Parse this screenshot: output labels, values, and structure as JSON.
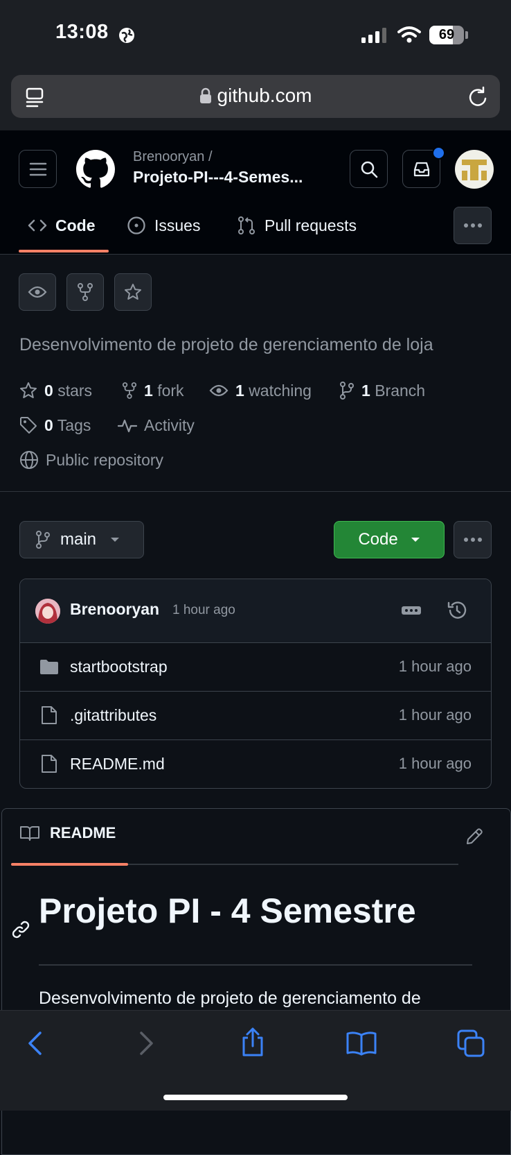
{
  "status_bar": {
    "time": "13:08",
    "battery": "69"
  },
  "browser": {
    "url": "github.com"
  },
  "header": {
    "owner": "Brenooryan /",
    "repo": "Projeto-PI---4-Semes..."
  },
  "nav": {
    "tabs": [
      {
        "label": "Code"
      },
      {
        "label": "Issues"
      },
      {
        "label": "Pull requests"
      }
    ]
  },
  "repo": {
    "description": "Desenvolvimento de projeto de gerenciamento de loja",
    "stars_count": "0",
    "stars_label": "stars",
    "fork_count": "1",
    "fork_label": "fork",
    "watching_count": "1",
    "watching_label": "watching",
    "branch_count": "1",
    "branch_label": "Branch",
    "tags_count": "0",
    "tags_label": "Tags",
    "activity_label": "Activity",
    "visibility": "Public repository"
  },
  "toolbar": {
    "branch": "main",
    "code_button": "Code"
  },
  "commit": {
    "author": "Brenooryan",
    "time": "1 hour ago"
  },
  "files": [
    {
      "name": "startbootstrap",
      "type": "folder",
      "time": "1 hour ago"
    },
    {
      "name": ".gitattributes",
      "type": "file",
      "time": "1 hour ago"
    },
    {
      "name": "README.md",
      "type": "file",
      "time": "1 hour ago"
    }
  ],
  "readme": {
    "tab_label": "README",
    "heading": "Projeto PI - 4 Semestre",
    "paragraph": "Desenvolvimento de projeto de gerenciamento de"
  },
  "colors": {
    "accent": "#f78166",
    "green": "#238636",
    "safari_blue": "#3b82f6"
  }
}
